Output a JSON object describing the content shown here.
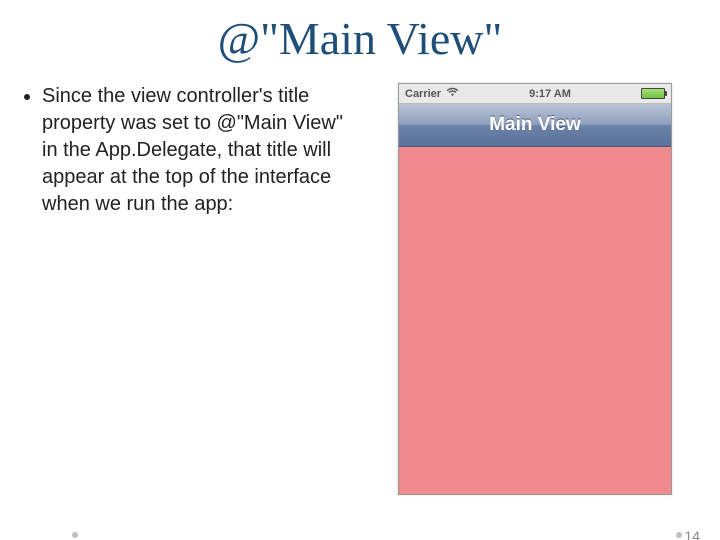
{
  "title": "@\"Main View\"",
  "bullet": "Since the view controller's title property was set to @\"Main View\" in the App.Delegate, that title will appear at the top of the interface when we run the app:",
  "phone": {
    "carrier": "Carrier",
    "time": "9:17 AM",
    "nav_title": "Main View"
  },
  "page_number": "14"
}
